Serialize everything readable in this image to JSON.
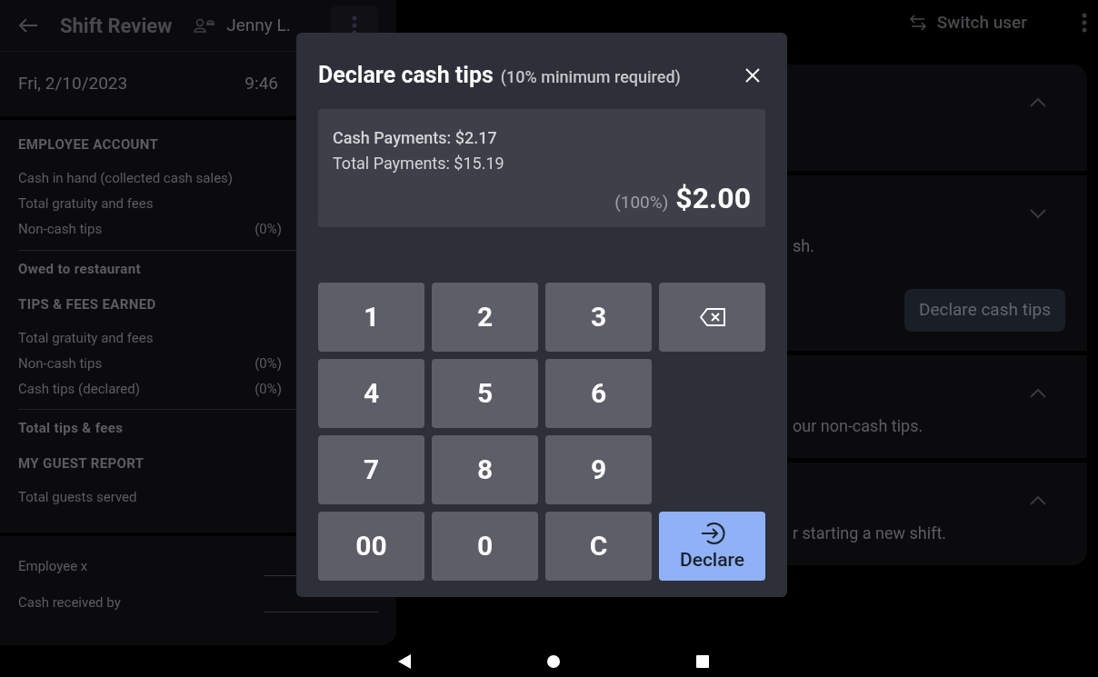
{
  "left_panel": {
    "title": "Shift Review",
    "user": "Jenny L.",
    "date": "Fri, 2/10/2023",
    "time": "9:46",
    "sections": [
      {
        "heading": "EMPLOYEE ACCOUNT",
        "rows": [
          {
            "label": "Cash in hand (collected cash sales)"
          },
          {
            "label": "Total gratuity and fees"
          },
          {
            "label": "Non-cash tips",
            "percent": "(0%)"
          }
        ],
        "total": "Owed to restaurant"
      },
      {
        "heading": "TIPS & FEES EARNED",
        "rows": [
          {
            "label": "Total gratuity and fees"
          },
          {
            "label": "Non-cash tips",
            "percent": "(0%)"
          },
          {
            "label": "Cash tips (declared)",
            "percent": "(0%)"
          }
        ],
        "total": "Total tips & fees"
      },
      {
        "heading": "MY GUEST REPORT",
        "rows": [
          {
            "label": "Total guests served"
          }
        ]
      }
    ],
    "signatures": [
      {
        "label": "Employee x"
      },
      {
        "label": "Cash received by"
      }
    ]
  },
  "top_bar": {
    "switch_user": "Switch user"
  },
  "cards": [
    {
      "expanded": true
    },
    {
      "expanded": false,
      "text": "sh.",
      "button": "Declare cash tips"
    },
    {
      "expanded": true,
      "text": "our non-cash tips."
    },
    {
      "expanded": true,
      "text": "r starting a new shift."
    }
  ],
  "dialog": {
    "title": "Declare cash tips",
    "subtitle": "(10% minimum required)",
    "cash_payments": "Cash Payments: $2.17",
    "total_payments": "Total Payments: $15.19",
    "percent": "(100%)",
    "amount": "$2.00",
    "keys": [
      {
        "kind": "digit",
        "label": "1"
      },
      {
        "kind": "digit",
        "label": "2"
      },
      {
        "kind": "digit",
        "label": "3"
      },
      {
        "kind": "backspace"
      },
      {
        "kind": "digit",
        "label": "4"
      },
      {
        "kind": "digit",
        "label": "5"
      },
      {
        "kind": "digit",
        "label": "6"
      },
      {
        "kind": "digit",
        "label": "7"
      },
      {
        "kind": "digit",
        "label": "8"
      },
      {
        "kind": "digit",
        "label": "9"
      },
      {
        "kind": "digit",
        "label": "00"
      },
      {
        "kind": "digit",
        "label": "0"
      },
      {
        "kind": "digit",
        "label": "C"
      },
      {
        "kind": "declare",
        "label": "Declare"
      }
    ]
  }
}
